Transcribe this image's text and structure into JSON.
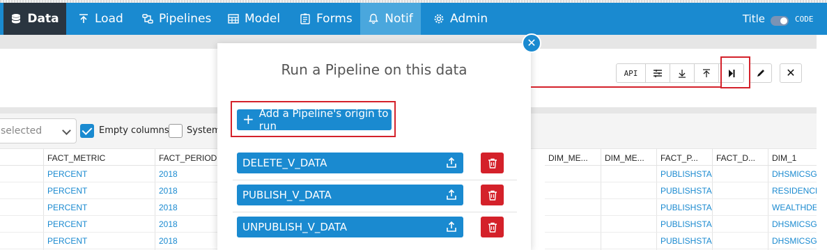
{
  "navbar": {
    "items": [
      {
        "label": "Data",
        "icon": "database-icon"
      },
      {
        "label": "Load",
        "icon": "upload-icon"
      },
      {
        "label": "Pipelines",
        "icon": "pipelines-icon"
      },
      {
        "label": "Model",
        "icon": "table-icon"
      },
      {
        "label": "Forms",
        "icon": "form-icon"
      },
      {
        "label": "Notif",
        "icon": "bell-icon"
      },
      {
        "label": "Admin",
        "icon": "gear-icon"
      }
    ],
    "title_label": "Title",
    "code_label": "CODE",
    "colors": {
      "bar": "#1a8ad0",
      "active_dark": "#2a3540",
      "active_light": "#4aa7dd"
    }
  },
  "toolbar": {
    "api_label": "API",
    "buttons": [
      "columns-icon",
      "download-icon",
      "upload-icon",
      "run-pipeline-icon"
    ]
  },
  "filters": {
    "select_text": "selected",
    "empty_columns_label": "Empty columns",
    "empty_columns_checked": true,
    "system_label": "System",
    "system_checked": false
  },
  "grid": {
    "headers": [
      "FACT_METRIC",
      "FACT_PERIOD",
      "DIM_ME...",
      "DIM_ME...",
      "FACT_P...",
      "FACT_D...",
      "DIM_1"
    ],
    "rows": [
      {
        "metric": "PERCENT",
        "period": "2018",
        "fact_p": "PUBLISHSTA",
        "dim1": "DHSMICSGI"
      },
      {
        "metric": "PERCENT",
        "period": "2018",
        "fact_p": "PUBLISHSTA",
        "dim1": "RESIDENCE"
      },
      {
        "metric": "PERCENT",
        "period": "2018",
        "fact_p": "PUBLISHSTA",
        "dim1": "WEALTHDE"
      },
      {
        "metric": "PERCENT",
        "period": "2018",
        "fact_p": "PUBLISHSTA",
        "dim1": "DHSMICSGI"
      },
      {
        "metric": "PERCENT",
        "period": "2018",
        "fact_p": "PUBLISHSTA",
        "dim1": "DHSMICSGI"
      }
    ]
  },
  "modal": {
    "title": "Run a Pipeline on this data",
    "add_button_label": "Add a Pipeline's origin to run",
    "pipelines": [
      {
        "name": "DELETE_V_DATA"
      },
      {
        "name": "PUBLISH_V_DATA"
      },
      {
        "name": "UNPUBLISH_V_DATA"
      }
    ],
    "colors": {
      "primary": "#1a8ad0",
      "danger": "#d4212a",
      "highlight": "#d4212a"
    }
  }
}
